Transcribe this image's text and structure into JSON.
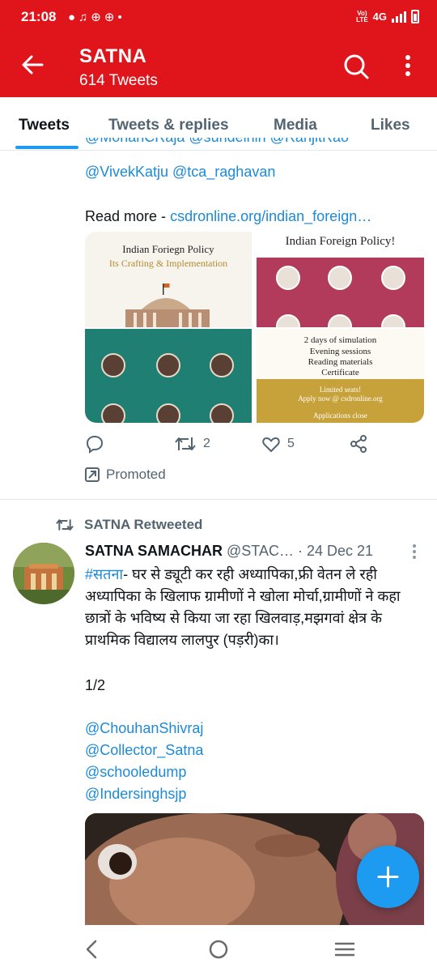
{
  "status_bar": {
    "time": "21:08",
    "network": "4G",
    "volte": "Vo) LTE"
  },
  "header": {
    "title": "SATNA",
    "subtitle": "614 Tweets"
  },
  "tabs": [
    {
      "label": "Tweets",
      "active": true
    },
    {
      "label": "Tweets & replies",
      "active": false
    },
    {
      "label": "Media",
      "active": false
    },
    {
      "label": "Likes",
      "active": false
    }
  ],
  "tweet1": {
    "cut_mentions": "@MohanCRaja @sundeinin @RanjitRao",
    "mentions": "@VivekKatju @tca_raghavan",
    "read_more_label": "Read more -",
    "read_more_link": "csdronline.org/indian_foreign…",
    "media": {
      "img1_title": "Indian Foriegn Policy",
      "img1_subtitle": "Its Crafting & Implementation",
      "img2_title": "Indian Foreign Policy!",
      "img4_lines": [
        "2 days of simulation",
        "Evening sessions",
        "Reading materials",
        "Certificate"
      ],
      "img4_gold": [
        "Limited seats!",
        "Apply now @ csdronline.org",
        "Applications close"
      ]
    },
    "retweets": "2",
    "likes": "5",
    "promoted_label": "Promoted"
  },
  "tweet2": {
    "retweeted_by": "SATNA Retweeted",
    "name": "SATNA SAMACHAR",
    "handle_date": "@STAC… · 24 Dec 21",
    "hashtag": "#सतना",
    "body": "- घर से ड्यूटी कर रही अध्यापिका,फ्री वेतन ले रही अध्यापिका के खिलाफ ग्रामीणों ने खोला मोर्चा,ग्रामीणों ने कहा छात्रों के भविष्य से किया जा रहा खिलवाड़,मझगवां क्षेत्र के प्राथमिक विद्यालय लालपुर (पड़री)का।",
    "count": "1/2",
    "mentions": [
      "@ChouhanShivraj",
      "@Collector_Satna",
      "@schooledump",
      "@Indersinghsjp"
    ]
  },
  "colors": {
    "brand_red": "#e0151b",
    "accent_blue": "#1d9bf0",
    "link": "#1b8ad8",
    "muted": "#536471"
  }
}
